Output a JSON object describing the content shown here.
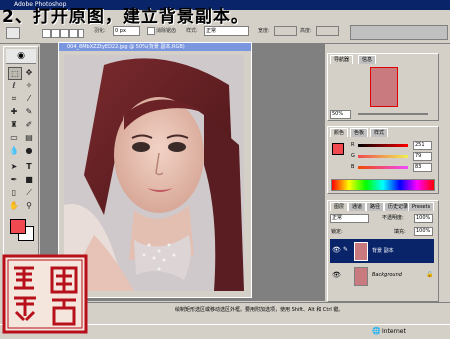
{
  "title": {
    "app": "Adobe Photoshop",
    "step": "2、打开原图，建立背景副本。"
  },
  "options": {
    "feather_label": "羽化:",
    "feather_value": "0 px",
    "antialias_label": "消除锯齿",
    "style_label": "样式:",
    "style_value": "正常",
    "width_label": "宽度:",
    "height_label": "高度:"
  },
  "document": {
    "title": "004_8MbXZZtyED22.jpg @ 50%(背景 副本,RGB)"
  },
  "navigator": {
    "tab1": "导航器",
    "tab2": "信息",
    "zoom": "50%"
  },
  "color": {
    "tab1": "颜色",
    "tab2": "色板",
    "tab3": "样式",
    "r_label": "R",
    "g_label": "G",
    "b_label": "B",
    "r_value": "251",
    "g_value": "79",
    "b_value": "83",
    "swatch_fg": "#f04a50"
  },
  "layers": {
    "tab1": "图层",
    "tab2": "通道",
    "tab3": "路径",
    "tab4": "历史记录",
    "tab5": "Presets",
    "blend_mode": "正常",
    "opacity_label": "不透明度:",
    "opacity_value": "100%",
    "lock_label": "锁定:",
    "fill_label": "填充:",
    "fill_value": "100%",
    "items": [
      {
        "name": "背景 副本",
        "selected": true
      },
      {
        "name": "Background",
        "selected": false
      }
    ]
  },
  "status": {
    "text": "绘制矩形选区或移动选区外框。要用附加选项，使用 Shift、Alt 和 Ctrl 键。"
  },
  "taskbar": {
    "internet": "Internet"
  },
  "colors": {
    "titlebar": "#0a246a",
    "selection": "#0a246a",
    "seal_red": "#b8101a"
  }
}
